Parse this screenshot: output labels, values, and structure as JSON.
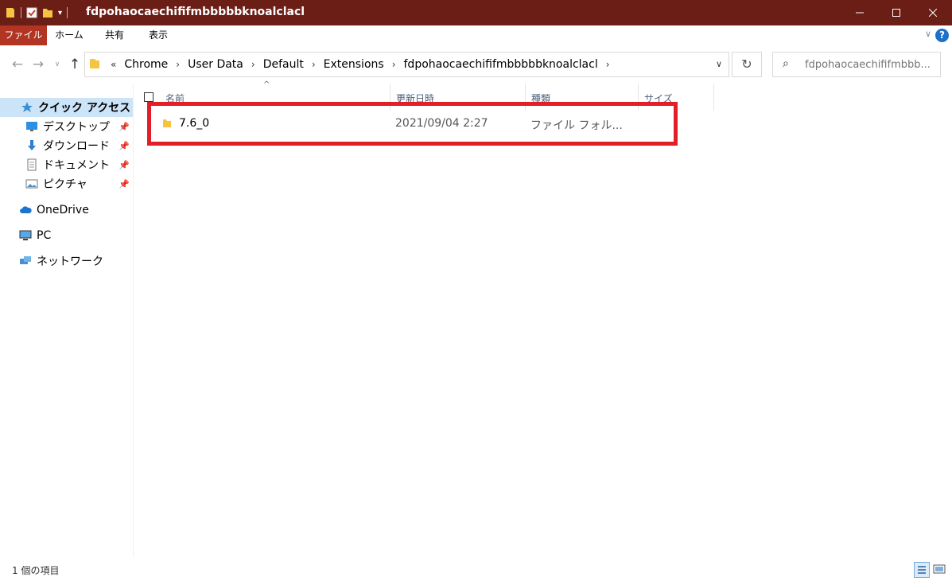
{
  "window": {
    "title": "fdpohaocaechififmbbbbbknoalclacl",
    "colors": {
      "titlebar": "#6b1e16",
      "file_tab": "#b23423",
      "highlight": "#e21f26",
      "selection": "#cce4f7"
    }
  },
  "ribbon": {
    "tabs": [
      "ファイル",
      "ホーム",
      "共有",
      "表示"
    ]
  },
  "address": {
    "overflow": "«",
    "crumbs": [
      "Chrome",
      "User Data",
      "Default",
      "Extensions",
      "fdpohaocaechififmbbbbbknoalclacl"
    ]
  },
  "search": {
    "placeholder": "fdpohaocaechififmbbb..."
  },
  "sidebar": {
    "items": [
      {
        "label": "クイック アクセス",
        "icon": "star-icon"
      },
      {
        "label": "デスクトップ",
        "icon": "desktop-icon"
      },
      {
        "label": "ダウンロード",
        "icon": "download-icon"
      },
      {
        "label": "ドキュメント",
        "icon": "document-icon"
      },
      {
        "label": "ピクチャ",
        "icon": "pictures-icon"
      },
      {
        "label": "OneDrive",
        "icon": "cloud-icon"
      },
      {
        "label": "PC",
        "icon": "pc-icon"
      },
      {
        "label": "ネットワーク",
        "icon": "network-icon"
      }
    ]
  },
  "columns": [
    "名前",
    "更新日時",
    "種類",
    "サイズ"
  ],
  "files": [
    {
      "name": "7.6_0",
      "modified": "2021/09/04 2:27",
      "type": "ファイル フォル...",
      "size": ""
    }
  ],
  "status": {
    "count_text": "1 個の項目"
  }
}
